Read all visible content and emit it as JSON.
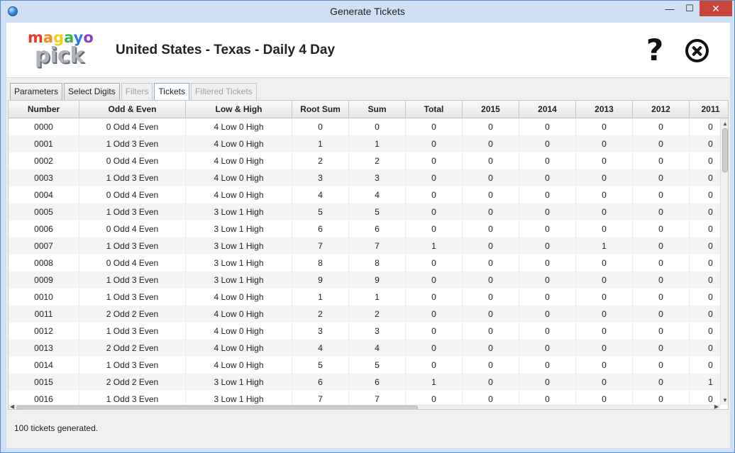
{
  "window": {
    "title": "Generate Tickets",
    "minimize": "—",
    "maximize": "☐",
    "close": "✕"
  },
  "header": {
    "logo_top": [
      "m",
      "a",
      "g",
      "a",
      "y",
      "o"
    ],
    "logo_bottom": "pick",
    "game_title": "United States - Texas - Daily 4 Day",
    "help_label": "?"
  },
  "tabs": [
    {
      "label": "Parameters",
      "state": "normal"
    },
    {
      "label": "Select Digits",
      "state": "normal"
    },
    {
      "label": "Filters",
      "state": "disabled"
    },
    {
      "label": "Tickets",
      "state": "active"
    },
    {
      "label": "Filtered Tickets",
      "state": "disabled"
    }
  ],
  "table": {
    "columns": [
      "Number",
      "Odd & Even",
      "Low & High",
      "Root Sum",
      "Sum",
      "Total",
      "2015",
      "2014",
      "2013",
      "2012",
      "2011"
    ],
    "rows": [
      [
        "0000",
        "0 Odd 4 Even",
        "4 Low 0 High",
        "0",
        "0",
        "0",
        "0",
        "0",
        "0",
        "0",
        "0"
      ],
      [
        "0001",
        "1 Odd 3 Even",
        "4 Low 0 High",
        "1",
        "1",
        "0",
        "0",
        "0",
        "0",
        "0",
        "0"
      ],
      [
        "0002",
        "0 Odd 4 Even",
        "4 Low 0 High",
        "2",
        "2",
        "0",
        "0",
        "0",
        "0",
        "0",
        "0"
      ],
      [
        "0003",
        "1 Odd 3 Even",
        "4 Low 0 High",
        "3",
        "3",
        "0",
        "0",
        "0",
        "0",
        "0",
        "0"
      ],
      [
        "0004",
        "0 Odd 4 Even",
        "4 Low 0 High",
        "4",
        "4",
        "0",
        "0",
        "0",
        "0",
        "0",
        "0"
      ],
      [
        "0005",
        "1 Odd 3 Even",
        "3 Low 1 High",
        "5",
        "5",
        "0",
        "0",
        "0",
        "0",
        "0",
        "0"
      ],
      [
        "0006",
        "0 Odd 4 Even",
        "3 Low 1 High",
        "6",
        "6",
        "0",
        "0",
        "0",
        "0",
        "0",
        "0"
      ],
      [
        "0007",
        "1 Odd 3 Even",
        "3 Low 1 High",
        "7",
        "7",
        "1",
        "0",
        "0",
        "1",
        "0",
        "0"
      ],
      [
        "0008",
        "0 Odd 4 Even",
        "3 Low 1 High",
        "8",
        "8",
        "0",
        "0",
        "0",
        "0",
        "0",
        "0"
      ],
      [
        "0009",
        "1 Odd 3 Even",
        "3 Low 1 High",
        "9",
        "9",
        "0",
        "0",
        "0",
        "0",
        "0",
        "0"
      ],
      [
        "0010",
        "1 Odd 3 Even",
        "4 Low 0 High",
        "1",
        "1",
        "0",
        "0",
        "0",
        "0",
        "0",
        "0"
      ],
      [
        "0011",
        "2 Odd 2 Even",
        "4 Low 0 High",
        "2",
        "2",
        "0",
        "0",
        "0",
        "0",
        "0",
        "0"
      ],
      [
        "0012",
        "1 Odd 3 Even",
        "4 Low 0 High",
        "3",
        "3",
        "0",
        "0",
        "0",
        "0",
        "0",
        "0"
      ],
      [
        "0013",
        "2 Odd 2 Even",
        "4 Low 0 High",
        "4",
        "4",
        "0",
        "0",
        "0",
        "0",
        "0",
        "0"
      ],
      [
        "0014",
        "1 Odd 3 Even",
        "4 Low 0 High",
        "5",
        "5",
        "0",
        "0",
        "0",
        "0",
        "0",
        "0"
      ],
      [
        "0015",
        "2 Odd 2 Even",
        "3 Low 1 High",
        "6",
        "6",
        "1",
        "0",
        "0",
        "0",
        "0",
        "1"
      ],
      [
        "0016",
        "1 Odd 3 Even",
        "3 Low 1 High",
        "7",
        "7",
        "0",
        "0",
        "0",
        "0",
        "0",
        "0"
      ]
    ]
  },
  "status": {
    "text": "100 tickets generated."
  },
  "icons": {
    "help": "question-mark-icon",
    "close": "close-circle-icon",
    "app": "app-orb-icon"
  }
}
